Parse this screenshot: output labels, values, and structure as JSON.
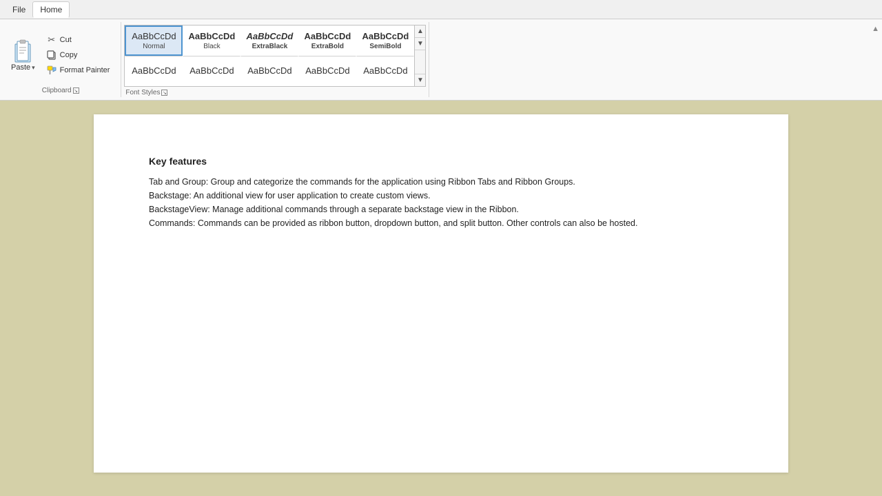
{
  "menubar": {
    "items": [
      {
        "label": "File",
        "active": false
      },
      {
        "label": "Home",
        "active": true
      }
    ]
  },
  "ribbon": {
    "clipboard_group": {
      "label": "Clipboard",
      "paste_label": "Paste",
      "paste_dropdown": "▾",
      "cut_label": "Cut",
      "copy_label": "Copy",
      "format_painter_label": "Format Painter"
    },
    "font_styles_group": {
      "label": "Font Styles",
      "styles_row1": [
        {
          "sample": "AaBbCcDd",
          "name": "Normal",
          "selected": true
        },
        {
          "sample": "AaBbCcDd",
          "name": "Black",
          "bold": true
        },
        {
          "sample": "AaBbCcDd",
          "name": "ExtraBlack",
          "extra_black": true
        },
        {
          "sample": "AaBbCcDd",
          "name": "ExtraBold",
          "extra_bold": true
        },
        {
          "sample": "AaBbCcDd",
          "name": "SemiBold",
          "semi_bold": true
        }
      ],
      "styles_row2": [
        {
          "sample": "AaBbCcDd",
          "name": ""
        },
        {
          "sample": "AaBbCcDd",
          "name": ""
        },
        {
          "sample": "AaBbCcDd",
          "name": ""
        },
        {
          "sample": "AaBbCcDd",
          "name": ""
        },
        {
          "sample": "AaBbCcDd",
          "name": ""
        }
      ]
    }
  },
  "document": {
    "heading": "Key features",
    "lines": [
      "Tab and Group: Group and categorize the commands for the application using Ribbon Tabs and Ribbon Groups.",
      "Backstage: An additional view for user application to create custom views.",
      "BackstageView: Manage additional commands through a separate backstage view in the Ribbon.",
      "Commands: Commands can be provided as ribbon button, dropdown button, and split button. Other controls can also be hosted."
    ]
  }
}
